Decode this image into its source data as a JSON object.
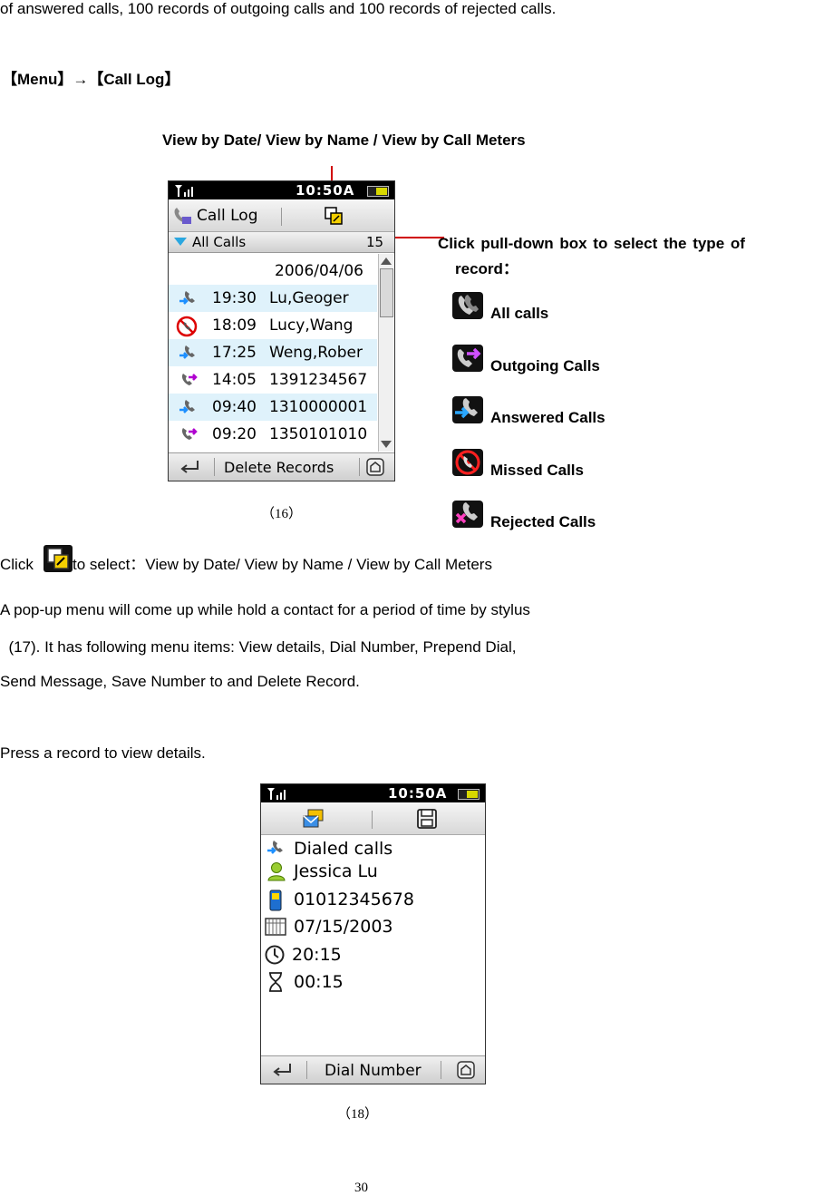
{
  "top_line": "of answered calls, 100 records of outgoing calls and 100 records of rejected calls.",
  "menu_path": "【Menu】→【Call Log】",
  "view_options": "View by Date/ View by Name / View by Call Meters",
  "fig1": {
    "time": "10:50A",
    "title": "Call Log",
    "dropdown_label": "All Calls",
    "dropdown_count": "15",
    "date": "2006/04/06",
    "rows": [
      {
        "time": "19:30",
        "name": "Lu,Geoger"
      },
      {
        "time": "18:09",
        "name": "Lucy,Wang"
      },
      {
        "time": "17:25",
        "name": "Weng,Rober"
      },
      {
        "time": "14:05",
        "name": "1391234567"
      },
      {
        "time": "09:40",
        "name": "1310000001"
      },
      {
        "time": "09:20",
        "name": "1350101010"
      }
    ],
    "bottom_label": "Delete Records",
    "caption": "（16）"
  },
  "callout": {
    "line1": "Click  pull-down  box  to  select  the  type  of",
    "line2": "record："
  },
  "legend": [
    {
      "label": "All calls",
      "icon": "all-calls-icon"
    },
    {
      "label": "Outgoing Calls",
      "icon": "outgoing-calls-icon"
    },
    {
      "label": "Answered Calls",
      "icon": "answered-calls-icon"
    },
    {
      "label": "Missed Calls",
      "icon": "missed-calls-icon"
    },
    {
      "label": "Rejected Calls",
      "icon": "rejected-calls-icon"
    }
  ],
  "click_line": {
    "prefix": "Click ",
    "suffix": "to select：View by Date/ View by Name / View by Call Meters"
  },
  "para1": [
    "A pop-up menu will come up while hold a contact for a period of time by stylus",
    "  (17). It has following menu items: View details, Dial Number, Prepend Dial,",
    "Send Message, Save Number to and Delete Record."
  ],
  "para2": "Press a record to view details.",
  "fig2": {
    "time": "10:50A",
    "details": [
      {
        "text": "Dialed calls",
        "icon": "dialed-call-icon"
      },
      {
        "text": "Jessica Lu",
        "icon": "contact-icon"
      },
      {
        "text": "01012345678",
        "icon": "mobile-phone-icon"
      },
      {
        "text": "07/15/2003",
        "icon": "calendar-icon"
      },
      {
        "text": "20:15",
        "icon": "clock-icon"
      },
      {
        "text": "00:15",
        "icon": "hourglass-icon"
      }
    ],
    "bottom_label": "Dial Number",
    "caption": "（18）"
  },
  "page_number": "30"
}
